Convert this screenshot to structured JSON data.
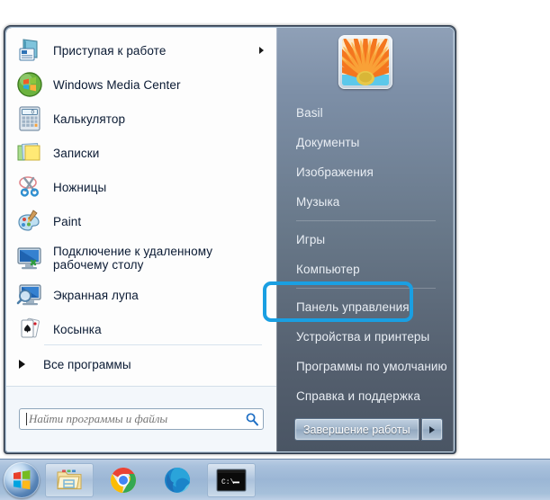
{
  "start_menu": {
    "left_panel": {
      "programs": [
        {
          "label": "Приступая к работе",
          "icon": "getting-started-icon",
          "has_submenu": true
        },
        {
          "label": "Windows Media Center",
          "icon": "windows-media-center-icon",
          "has_submenu": false
        },
        {
          "label": "Калькулятор",
          "icon": "calculator-icon",
          "has_submenu": false
        },
        {
          "label": "Записки",
          "icon": "sticky-notes-icon",
          "has_submenu": false
        },
        {
          "label": "Ножницы",
          "icon": "snipping-tool-icon",
          "has_submenu": false
        },
        {
          "label": "Paint",
          "icon": "paint-icon",
          "has_submenu": false
        },
        {
          "label": "Подключение к удаленному рабочему столу",
          "icon": "remote-desktop-icon",
          "has_submenu": false
        },
        {
          "label": "Экранная лупа",
          "icon": "magnifier-icon",
          "has_submenu": false
        },
        {
          "label": "Косынка",
          "icon": "solitaire-icon",
          "has_submenu": false
        }
      ],
      "all_programs": {
        "label": "Все программы",
        "arrow_icon": "triangle-right-icon"
      },
      "search": {
        "placeholder": "Найти программы и файлы",
        "value": "",
        "icon": "search-icon"
      }
    },
    "right_panel": {
      "avatar": {
        "icon": "user-avatar-flower",
        "alt": "Basil"
      },
      "items": [
        {
          "label": "Basil",
          "separator_after": false
        },
        {
          "label": "Документы",
          "separator_after": false
        },
        {
          "label": "Изображения",
          "separator_after": false
        },
        {
          "label": "Музыка",
          "separator_after": true
        },
        {
          "label": "Игры",
          "separator_after": false
        },
        {
          "label": "Компьютер",
          "separator_after": true
        },
        {
          "label": "Панель управления",
          "separator_after": false,
          "highlighted": true
        },
        {
          "label": "Устройства и принтеры",
          "separator_after": false
        },
        {
          "label": "Программы по умолчанию",
          "separator_after": false
        },
        {
          "label": "Справка и поддержка",
          "separator_after": false
        }
      ],
      "shutdown": {
        "label": "Завершение работы",
        "arrow_icon": "triangle-right-icon"
      }
    }
  },
  "annotation": {
    "target_label": "Панель управления",
    "color": "#1a9fe2"
  },
  "taskbar": {
    "start_button": {
      "icon": "windows-start-orb"
    },
    "buttons": [
      {
        "icon": "file-explorer-icon",
        "name": "file-explorer"
      },
      {
        "icon": "google-chrome-icon",
        "name": "google-chrome"
      },
      {
        "icon": "microsoft-edge-icon",
        "name": "microsoft-edge"
      },
      {
        "icon": "command-prompt-icon",
        "name": "command-prompt",
        "caption": "C:\\"
      }
    ]
  }
}
